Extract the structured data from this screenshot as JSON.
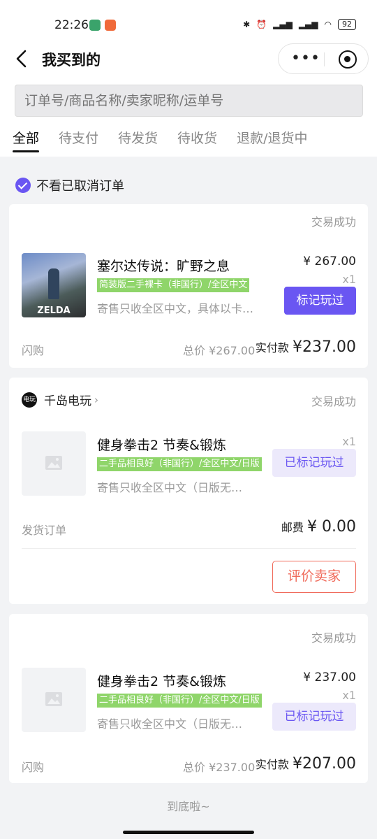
{
  "status_bar": {
    "time": "22:26",
    "battery": "92"
  },
  "header": {
    "title": "我买到的"
  },
  "search": {
    "placeholder": "订单号/商品名称/卖家昵称/运单号"
  },
  "tabs": [
    {
      "label": "全部",
      "active": true
    },
    {
      "label": "待支付"
    },
    {
      "label": "待发货"
    },
    {
      "label": "待收货"
    },
    {
      "label": "退款/退货中"
    }
  ],
  "filter": {
    "label": "不看已取消订单",
    "checked": true
  },
  "orders": [
    {
      "status": "交易成功",
      "product": {
        "name": "塞尔达传说：旷野之息",
        "tag": "简装版二手裸卡（非国行）/全区中文",
        "desc": "寄售只收全区中文，具体以卡…",
        "price": "¥ 267.00",
        "qty": "x1",
        "cover_text": "ZELDA"
      },
      "action": "标记玩过",
      "type_label": "闪购",
      "total": "总价 ¥267.00",
      "paid_label": "实付款",
      "paid_value": "¥237.00"
    },
    {
      "store": {
        "name": "千岛电玩",
        "avatar_text": "电玩"
      },
      "status": "交易成功",
      "product": {
        "name": "健身拳击2 节奏&锻炼",
        "tag": "二手品相良好（非国行）/全区中文/日版",
        "desc": "寄售只收全区中文（日版无…",
        "qty": "x1"
      },
      "action": "已标记玩过",
      "type_label": "发货订单",
      "postage_label": "邮费",
      "postage_value": "¥ 0.00",
      "review_button": "评价卖家"
    },
    {
      "status": "交易成功",
      "product": {
        "name": "健身拳击2 节奏&锻炼",
        "tag": "二手品相良好（非国行）/全区中文/日版",
        "desc": "寄售只收全区中文（日版无…",
        "price": "¥ 237.00",
        "qty": "x1"
      },
      "action": "已标记玩过",
      "type_label": "闪购",
      "total": "总价 ¥237.00",
      "paid_label": "实付款",
      "paid_value": "¥207.00"
    }
  ],
  "footer": {
    "end_text": "到底啦~"
  },
  "colors": {
    "accent": "#6a56f2",
    "tag_green": "#8fd56a",
    "review_red": "#f06a5a"
  }
}
